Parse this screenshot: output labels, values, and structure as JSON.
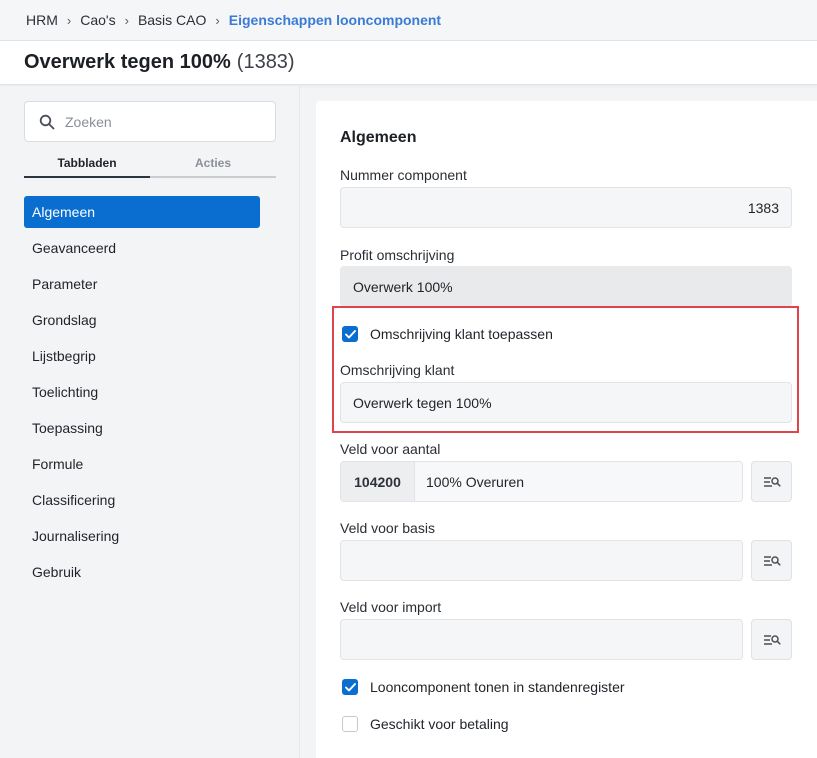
{
  "breadcrumb": [
    "HRM",
    "Cao's",
    "Basis CAO",
    "Eigenschappen looncomponent"
  ],
  "header": {
    "title": "Overwerk tegen 100%",
    "id_text": "(1383)"
  },
  "sidebar": {
    "search_placeholder": "Zoeken",
    "tabs": [
      {
        "label": "Tabbladen",
        "active": true
      },
      {
        "label": "Acties",
        "active": false
      }
    ],
    "items": [
      "Algemeen",
      "Geavanceerd",
      "Parameter",
      "Grondslag",
      "Lijstbegrip",
      "Toelichting",
      "Toepassing",
      "Formule",
      "Classificering",
      "Journalisering",
      "Gebruik"
    ],
    "active_item": "Algemeen"
  },
  "form": {
    "section_title": "Algemeen",
    "nummer_label": "Nummer component",
    "nummer_value": "1383",
    "profit_label": "Profit omschrijving",
    "profit_value": "Overwerk 100%",
    "klant_toepassen_label": "Omschrijving klant toepassen",
    "klant_toepassen_checked": true,
    "klant_label": "Omschrijving klant",
    "klant_value": "Overwerk tegen 100%",
    "aantal_label": "Veld voor aantal",
    "aantal_code": "104200",
    "aantal_desc": "100% Overuren",
    "basis_label": "Veld voor basis",
    "basis_value": "",
    "import_label": "Veld voor import",
    "import_value": "",
    "standen_label": "Looncomponent tonen in standenregister",
    "standen_checked": true,
    "betaling_label": "Geschikt voor betaling",
    "betaling_checked": false
  },
  "colors": {
    "accent": "#0a6ed1",
    "highlight": "#e0434a",
    "breadcrumb_active": "#3a7bd5"
  },
  "icons": {
    "search": "search-icon",
    "lookup": "lookup-list-icon",
    "chevron": "chevron-right-icon",
    "check": "checkmark-icon"
  }
}
